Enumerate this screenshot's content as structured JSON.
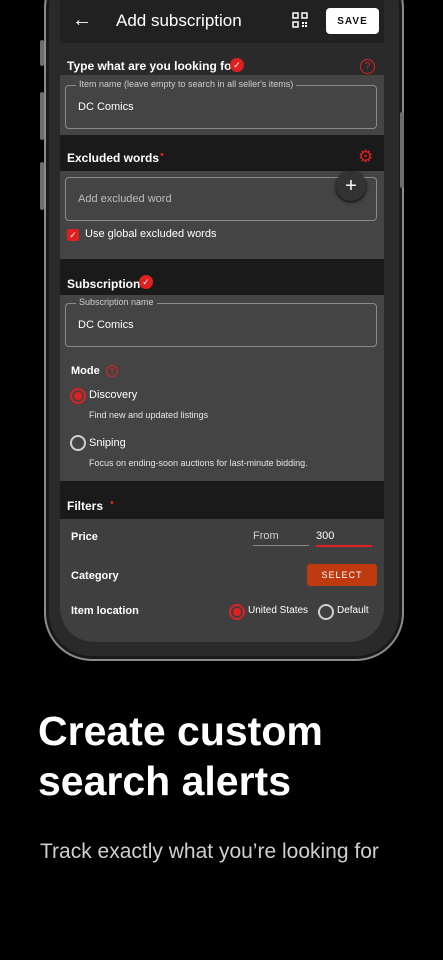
{
  "appbar": {
    "title": "Add subscription",
    "save_label": "SAVE"
  },
  "search_section": {
    "header": "Type what are you looking for",
    "field_label": "Item name (leave empty to search in all seller's items)",
    "field_value": "DC Comics"
  },
  "excluded_section": {
    "header": "Excluded words",
    "required_marker": "•",
    "placeholder": "Add excluded word",
    "checkbox_label": "Use global excluded words"
  },
  "subscription_section": {
    "header": "Subscription",
    "name_label": "Subscription name",
    "name_value": "DC Comics",
    "mode_label": "Mode",
    "modes": [
      {
        "label": "Discovery",
        "description": "Find new and updated listings",
        "selected": true
      },
      {
        "label": "Sniping",
        "description": "Focus on ending-soon auctions for last-minute bidding.",
        "selected": false
      }
    ]
  },
  "filters_section": {
    "header": "Filters",
    "required_marker": "•",
    "price_label": "Price",
    "price_from_placeholder": "From",
    "price_to_value": "300",
    "category_label": "Category",
    "select_label": "SELECT",
    "location_label": "Item location",
    "location_options": [
      {
        "label": "United States",
        "selected": true
      },
      {
        "label": "Default",
        "selected": false
      }
    ]
  },
  "promo": {
    "headline": "Create custom search alerts",
    "subline": "Track exactly what you’re looking for"
  },
  "colors": {
    "accent": "#e02020",
    "select_button": "#c03a10",
    "panel": "#444444",
    "background": "#000000"
  }
}
